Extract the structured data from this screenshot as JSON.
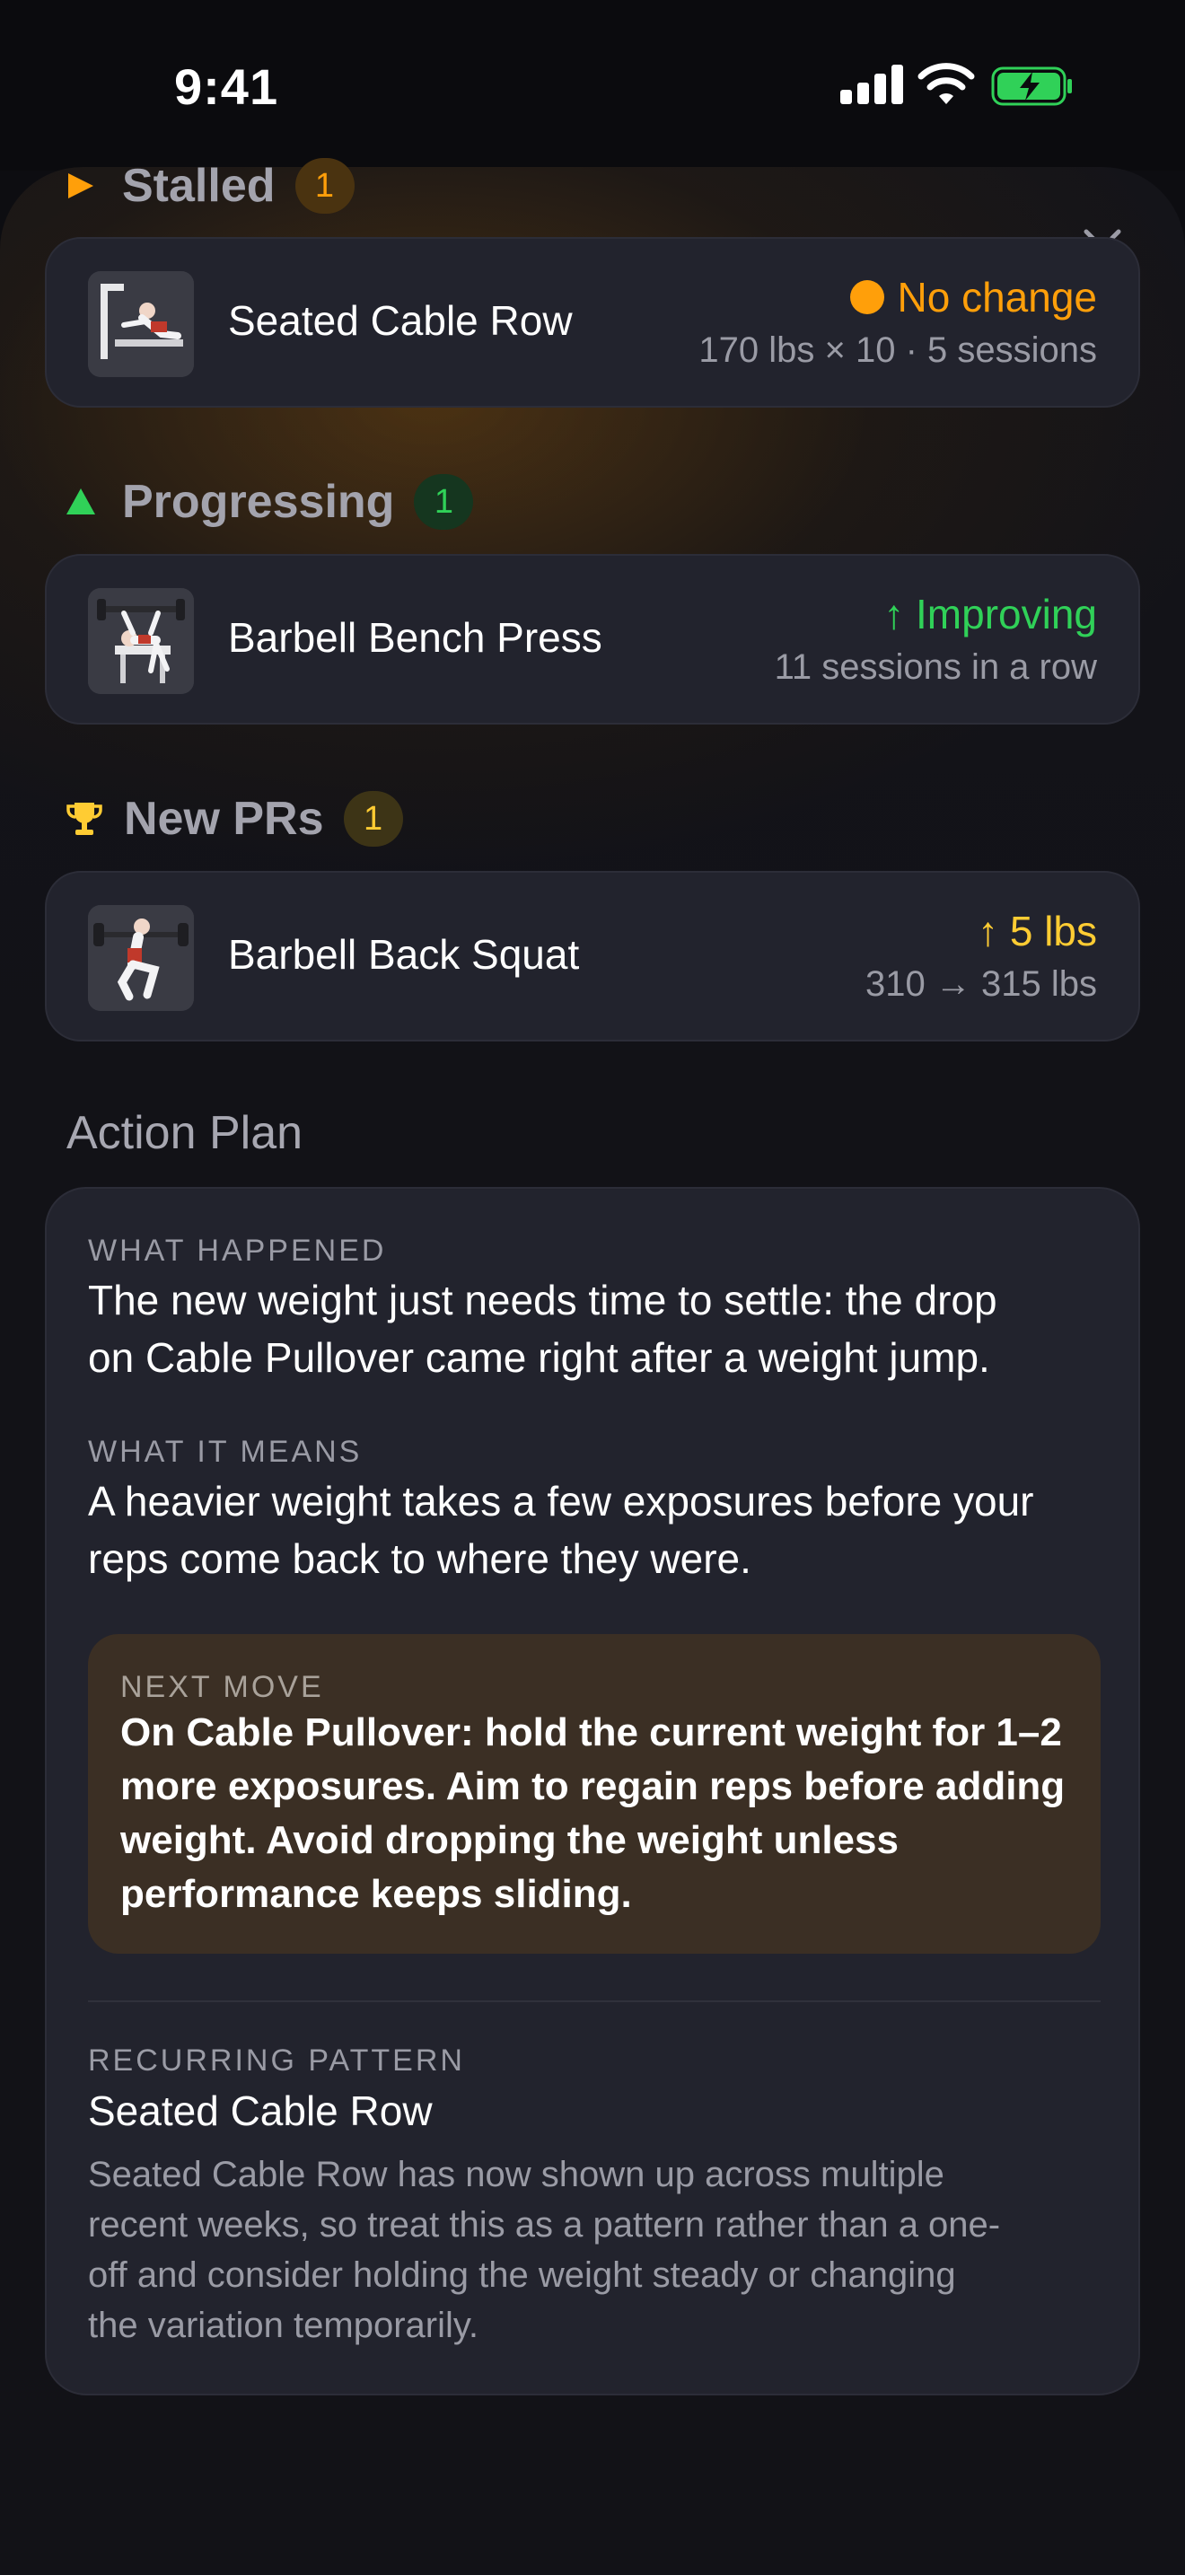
{
  "status_bar": {
    "time": "9:41"
  },
  "sections": {
    "stalled": {
      "title": "Stalled",
      "count": "1",
      "icon": "play-triangle-icon",
      "color": "#ff9f0a"
    },
    "progressing": {
      "title": "Progressing",
      "count": "1",
      "icon": "up-triangle-icon",
      "color": "#30d158"
    },
    "new_prs": {
      "title": "New PRs",
      "count": "1",
      "icon": "trophy-icon",
      "color": "#ffcc33"
    }
  },
  "exercises": {
    "stalled": {
      "name": "Seated Cable Row",
      "status": "No change",
      "detail": "170 lbs × 10 · 5 sessions"
    },
    "progressing": {
      "name": "Barbell Bench Press",
      "status": "↑ Improving",
      "detail": "11 sessions in a row"
    },
    "new_pr": {
      "name": "Barbell Back Squat",
      "status": "↑ 5 lbs",
      "detail": "310 → 315 lbs"
    }
  },
  "action_plan": {
    "title": "Action Plan",
    "what_happened_label": "WHAT HAPPENED",
    "what_happened_line1": "The new weight just needs time to settle: the drop",
    "what_happened_line2": "on Cable Pullover came right after a weight jump.",
    "what_it_means_label": "WHAT IT MEANS",
    "what_it_means_line1": "A heavier weight takes a few exposures before your",
    "what_it_means_line2": "reps come back to where they were.",
    "next_move_label": "NEXT MOVE",
    "next_move_line1": "On Cable Pullover: hold the current weight for 1–2",
    "next_move_line2": "more exposures. Aim to regain reps before adding",
    "next_move_line3": "weight. Avoid dropping the weight unless",
    "next_move_line4": "performance keeps sliding.",
    "recurring_label": "RECURRING PATTERN",
    "recurring_title": "Seated Cable Row",
    "recurring_line1": "Seated Cable Row has now shown up across multiple",
    "recurring_line2": "recent weeks, so treat this as a pattern rather than a one-",
    "recurring_line3": "off and consider holding the weight steady or changing",
    "recurring_line4": "the variation temporarily."
  },
  "colors": {
    "stalled": "#ff9f0a",
    "improving": "#30d158",
    "pr": "#ffcc33"
  }
}
